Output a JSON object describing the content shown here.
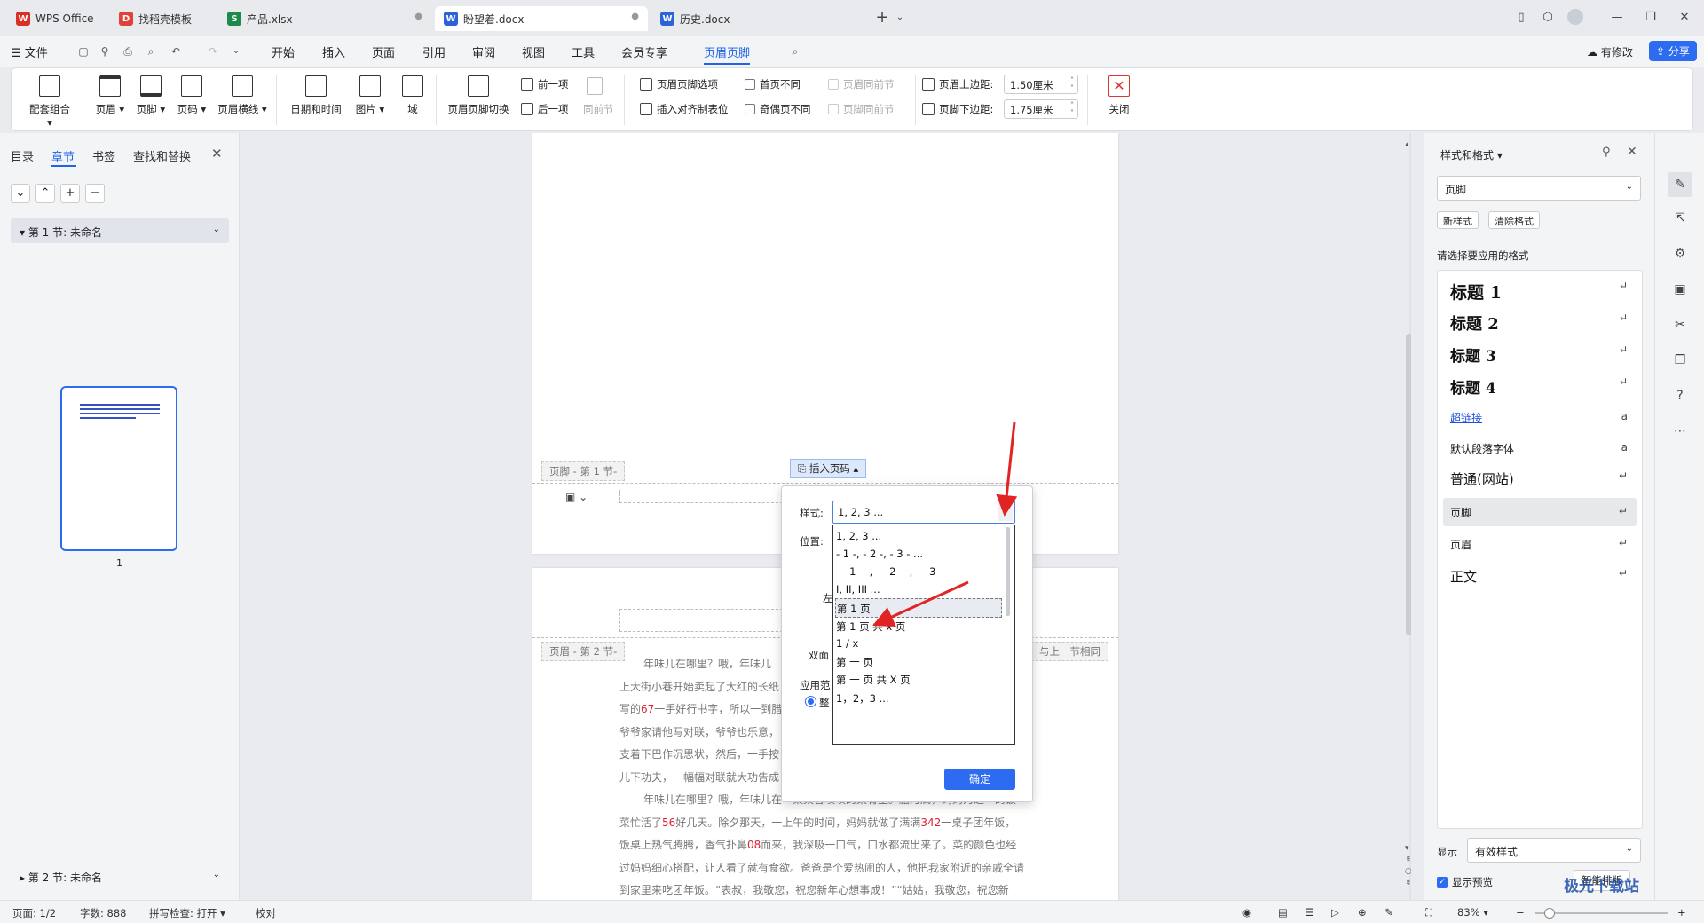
{
  "tabs": [
    {
      "label": "WPS Office",
      "icon": "W",
      "color": "#d93025"
    },
    {
      "label": "找稻壳模板",
      "icon": "D",
      "color": "#e0423a"
    },
    {
      "label": "产品.xlsx",
      "icon": "S",
      "color": "#1c8a4c"
    },
    {
      "label": "盼望着.docx",
      "icon": "W",
      "color": "#2b63d9"
    },
    {
      "label": "历史.docx",
      "icon": "W",
      "color": "#2b63d9"
    }
  ],
  "menu": {
    "file": "文件",
    "items": [
      "开始",
      "插入",
      "页面",
      "引用",
      "审阅",
      "视图",
      "工具",
      "会员专享",
      "页眉页脚"
    ],
    "active_index": 8,
    "modified": "有修改",
    "share": "分享"
  },
  "ribbon": {
    "big": [
      "配套组合",
      "页眉",
      "页脚",
      "页码",
      "页眉横线",
      "日期和时间",
      "图片",
      "域",
      "页眉页脚切换"
    ],
    "prev": "前一项",
    "next": "后一项",
    "same_prev": "同前节",
    "hf_options": "页眉页脚选项",
    "insert_align": "插入对齐制表位",
    "first_diff": "首页不同",
    "odd_even_diff": "奇偶页不同",
    "header_same_prev": "页眉同前节",
    "footer_same_prev": "页脚同前节",
    "header_top": "页眉上边距:",
    "footer_bottom": "页脚下边距:",
    "header_top_value": "1.50厘米",
    "footer_bottom_value": "1.75厘米",
    "close": "关闭"
  },
  "left_panel": {
    "tabs": [
      "目录",
      "章节",
      "书签",
      "查找和替换"
    ],
    "active_tab": 1,
    "section1": "第 1 节: 未命名",
    "section2": "第 2 节: 未命名",
    "page_num": "1"
  },
  "document": {
    "footer1_label": "页脚 - 第 1 节-",
    "header2_label": "页眉 - 第 2 节-",
    "same_as_prev": "与上一节相同",
    "insert_page_num": "插入页码",
    "paragraphs": [
      "年味儿在哪里？哦，年味儿",
      "上大街小巷开始卖起了大红的长纸",
      "写的",
      "爷爷家请他写对联，爷爷也乐意，",
      "支着下巴作沉思状，然后，一手按",
      "儿下功夫，一幅幅对联就大功告成",
      "年味儿在哪里？哦，年味儿在一桌桌香喷喷的菜肴里。腊月底，妈妈为过年的饭",
      "菜忙活了",
      "饭桌上热气腾腾，香气扑鼻",
      "过妈妈细心搭配，让人看了就有食欲。爸爸是个爱热闹的人，他把我家附近的亲戚全请",
      "到家里来吃团年饭。“表叔，我敬您，祝您新年心想事成！”“姑姑，我敬您，祝您新"
    ],
    "nums": {
      "n67": "67",
      "n56": "56",
      "n342": "342",
      "n08": "08"
    },
    "frag": {
      "a": "一手好行书字，所以一到腊",
      "b": "好几天。除夕那天，一上午的时间，妈妈就做了满满",
      "c": "一桌子团年饭，",
      "d": "而来，我深吸一口气，口水都流出来了。菜的颜色也经"
    }
  },
  "dialog": {
    "style_label": "样式:",
    "style_value": "1, 2, 3 ...",
    "position_label": "位置:",
    "left_partial": "左",
    "double_partial": "双面",
    "apply_partial": "应用范",
    "whole_partial": "整",
    "options": [
      "1, 2, 3 ...",
      "- 1 -, - 2 -, - 3 - ...",
      "— 1 —, — 2 —, — 3 —",
      "I, II, III ...",
      "第 1 页",
      "第 1 页 共 x 页",
      "1 / x",
      "第 一 页",
      "第 一 页 共 X 页",
      "1，2，3 ..."
    ],
    "selected_index": 4,
    "ok": "确定"
  },
  "right_panel": {
    "title": "样式和格式",
    "current_style": "页脚",
    "new_style": "新样式",
    "clear_format": "清除格式",
    "prompt": "请选择要应用的格式",
    "styles": [
      "标题 1",
      "标题 2",
      "标题 3",
      "标题 4",
      "超链接",
      "默认段落字体",
      "普通(网站)",
      "页脚",
      "页眉",
      "正文"
    ],
    "show_label": "显示",
    "show_value": "有效样式",
    "show_preview": "显示预览",
    "smart": "智能排版"
  },
  "status": {
    "page": "页面: 1/2",
    "words": "字数: 888",
    "spell": "拼写检查: 打开",
    "proof": "校对",
    "zoom": "83%"
  },
  "watermark": "极光下载站"
}
